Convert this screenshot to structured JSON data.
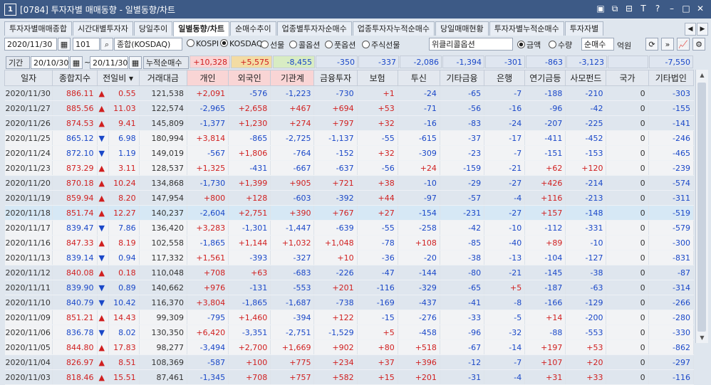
{
  "window": {
    "number": "1",
    "title": "[0784] 투자자별 매매동향 - 일별동향/차트",
    "icons": [
      "M",
      "restore",
      "minimize",
      "font",
      "help",
      "min",
      "max",
      "close"
    ]
  },
  "tabs": [
    "투자자별매매종합",
    "시간대별투자자",
    "당일추이",
    "일별동향/차트",
    "순매수추이",
    "업종별투자자순매수",
    "업종투자자누적순매수",
    "당일매매현황",
    "투자자별누적순매수",
    "투자자별"
  ],
  "active_tab": "일별동향/차트",
  "toolbar": {
    "date": "2020/11/30",
    "market_code": "101",
    "market_name": "종합(KOSDAQ)",
    "radios": [
      {
        "label": "KOSPI",
        "on": false
      },
      {
        "label": "KOSDAQ",
        "on": true
      },
      {
        "label": "선물",
        "on": false
      },
      {
        "label": "콜옵션",
        "on": false
      },
      {
        "label": "풋옵션",
        "on": false
      },
      {
        "label": "주식선물",
        "on": false
      }
    ],
    "weekly": "위클리콜옵션",
    "amount_radios": [
      {
        "label": "금액",
        "on": true
      },
      {
        "label": "수량",
        "on": false
      }
    ],
    "mode": "순매수",
    "unit": "억원"
  },
  "period": {
    "label": "기간",
    "from": "20/10/30",
    "to": "20/11/30",
    "cumulative_label": "누적순매수",
    "totals": [
      "+10,328",
      "+5,575",
      "-8,455",
      "-350",
      "-337",
      "-2,086",
      "-1,394",
      "-301",
      "-863",
      "-3,123",
      "",
      "-7,550"
    ]
  },
  "columns": [
    "일자",
    "종합지수",
    "전일비",
    "거래대금",
    "개인",
    "외국인",
    "기관계",
    "금융투자",
    "보험",
    "투신",
    "기타금융",
    "은행",
    "연기금등",
    "사모펀드",
    "국가",
    "기타법인"
  ],
  "rows": [
    [
      "2020/11/30",
      "886.11",
      "▲",
      "0.55",
      "121,538",
      "+2,091",
      "-576",
      "-1,223",
      "-730",
      "+1",
      "-24",
      "-65",
      "-7",
      "-188",
      "-210",
      "0",
      "-303"
    ],
    [
      "2020/11/27",
      "885.56",
      "▲",
      "11.03",
      "122,574",
      "-2,965",
      "+2,658",
      "+467",
      "+694",
      "+53",
      "-71",
      "-56",
      "-16",
      "-96",
      "-42",
      "0",
      "-155"
    ],
    [
      "2020/11/26",
      "874.53",
      "▲",
      "9.41",
      "145,809",
      "-1,377",
      "+1,230",
      "+274",
      "+797",
      "+32",
      "-16",
      "-83",
      "-24",
      "-207",
      "-225",
      "0",
      "-141"
    ],
    [
      "2020/11/25",
      "865.12",
      "▼",
      "6.98",
      "180,994",
      "+3,814",
      "-865",
      "-2,725",
      "-1,137",
      "-55",
      "-615",
      "-37",
      "-17",
      "-411",
      "-452",
      "0",
      "-246"
    ],
    [
      "2020/11/24",
      "872.10",
      "▼",
      "1.19",
      "149,019",
      "-567",
      "+1,806",
      "-764",
      "-152",
      "+32",
      "-309",
      "-23",
      "-7",
      "-151",
      "-153",
      "0",
      "-465"
    ],
    [
      "2020/11/23",
      "873.29",
      "▲",
      "3.11",
      "128,537",
      "+1,325",
      "-431",
      "-667",
      "-637",
      "-56",
      "+24",
      "-159",
      "-21",
      "+62",
      "+120",
      "0",
      "-239"
    ],
    [
      "2020/11/20",
      "870.18",
      "▲",
      "10.24",
      "134,868",
      "-1,730",
      "+1,399",
      "+905",
      "+721",
      "+38",
      "-10",
      "-29",
      "-27",
      "+426",
      "-214",
      "0",
      "-574"
    ],
    [
      "2020/11/19",
      "859.94",
      "▲",
      "8.20",
      "147,954",
      "+800",
      "+128",
      "-603",
      "-392",
      "+44",
      "-97",
      "-57",
      "-4",
      "+116",
      "-213",
      "0",
      "-311"
    ],
    [
      "2020/11/18",
      "851.74",
      "▲",
      "12.27",
      "140,237",
      "-2,604",
      "+2,751",
      "+390",
      "+767",
      "+27",
      "-154",
      "-231",
      "-27",
      "+157",
      "-148",
      "0",
      "-519"
    ],
    [
      "2020/11/17",
      "839.47",
      "▼",
      "7.86",
      "136,420",
      "+3,283",
      "-1,301",
      "-1,447",
      "-639",
      "-55",
      "-258",
      "-42",
      "-10",
      "-112",
      "-331",
      "0",
      "-579"
    ],
    [
      "2020/11/16",
      "847.33",
      "▲",
      "8.19",
      "102,558",
      "-1,865",
      "+1,144",
      "+1,032",
      "+1,048",
      "-78",
      "+108",
      "-85",
      "-40",
      "+89",
      "-10",
      "0",
      "-300"
    ],
    [
      "2020/11/13",
      "839.14",
      "▼",
      "0.94",
      "117,332",
      "+1,561",
      "-393",
      "-327",
      "+10",
      "-36",
      "-20",
      "-38",
      "-13",
      "-104",
      "-127",
      "0",
      "-831"
    ],
    [
      "2020/11/12",
      "840.08",
      "▲",
      "0.18",
      "110,048",
      "+708",
      "+63",
      "-683",
      "-226",
      "-47",
      "-144",
      "-80",
      "-21",
      "-145",
      "-38",
      "0",
      "-87"
    ],
    [
      "2020/11/11",
      "839.90",
      "▼",
      "0.89",
      "140,662",
      "+976",
      "-131",
      "-553",
      "+201",
      "-116",
      "-329",
      "-65",
      "+5",
      "-187",
      "-63",
      "0",
      "-314"
    ],
    [
      "2020/11/10",
      "840.79",
      "▼",
      "10.42",
      "116,370",
      "+3,804",
      "-1,865",
      "-1,687",
      "-738",
      "-169",
      "-437",
      "-41",
      "-8",
      "-166",
      "-129",
      "0",
      "-266"
    ],
    [
      "2020/11/09",
      "851.21",
      "▲",
      "14.43",
      "99,309",
      "-795",
      "+1,460",
      "-394",
      "+122",
      "-15",
      "-276",
      "-33",
      "-5",
      "+14",
      "-200",
      "0",
      "-280"
    ],
    [
      "2020/11/06",
      "836.78",
      "▼",
      "8.02",
      "130,350",
      "+6,420",
      "-3,351",
      "-2,751",
      "-1,529",
      "+5",
      "-458",
      "-96",
      "-32",
      "-88",
      "-553",
      "0",
      "-330"
    ],
    [
      "2020/11/05",
      "844.80",
      "▲",
      "17.83",
      "98,277",
      "-3,494",
      "+2,700",
      "+1,669",
      "+902",
      "+80",
      "+518",
      "-67",
      "-14",
      "+197",
      "+53",
      "0",
      "-862"
    ],
    [
      "2020/11/04",
      "826.97",
      "▲",
      "8.51",
      "108,369",
      "-587",
      "+100",
      "+775",
      "+234",
      "+37",
      "+396",
      "-12",
      "-7",
      "+107",
      "+20",
      "0",
      "-297"
    ],
    [
      "2020/11/03",
      "818.46",
      "▲",
      "15.51",
      "87,461",
      "-1,345",
      "+708",
      "+757",
      "+582",
      "+15",
      "+201",
      "-31",
      "-4",
      "+31",
      "+33",
      "0",
      "-116"
    ]
  ]
}
